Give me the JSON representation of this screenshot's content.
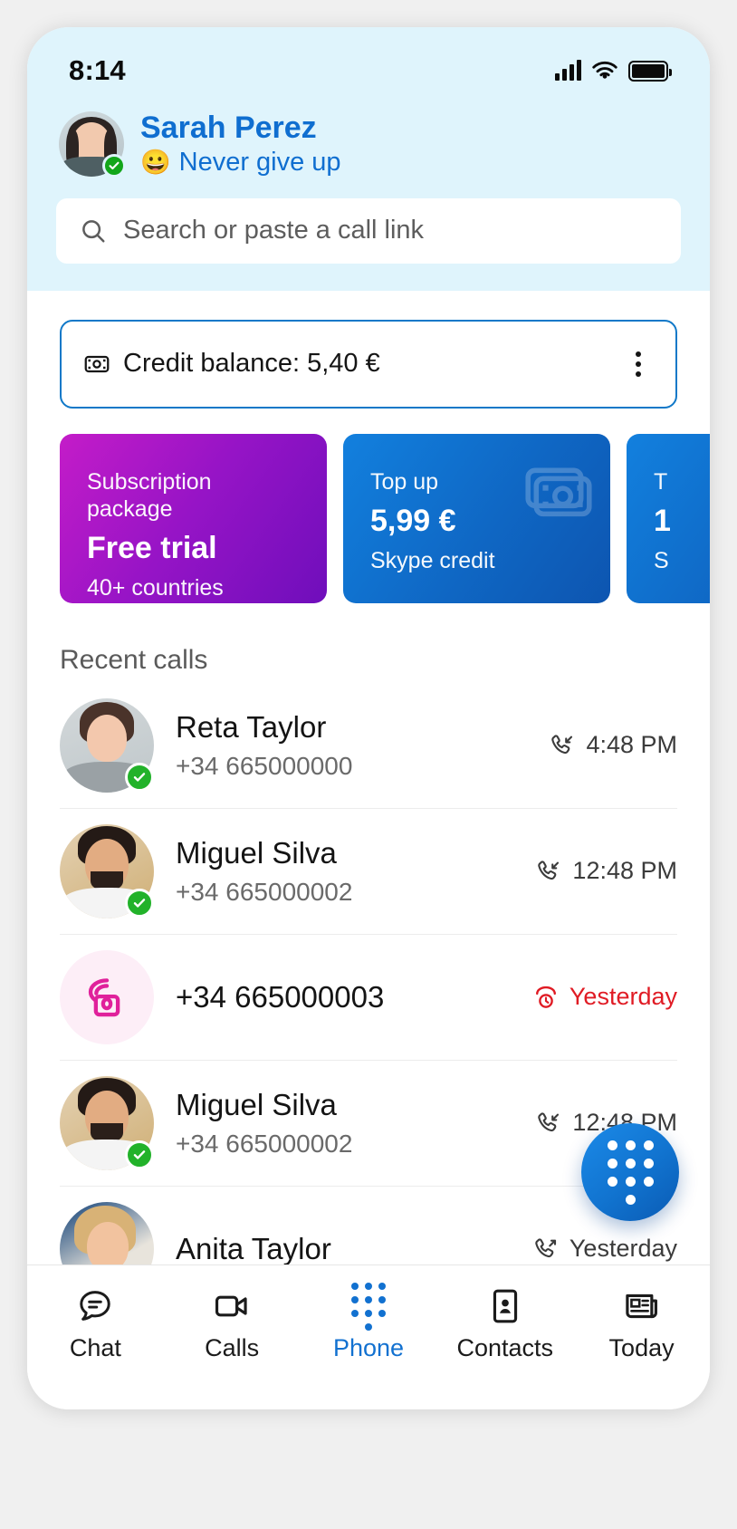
{
  "status_bar": {
    "time": "8:14",
    "signal_icon": "cellular-signal-icon",
    "wifi_icon": "wifi-icon",
    "battery_icon": "battery-full-icon"
  },
  "profile": {
    "name": "Sarah Perez",
    "mood_emoji": "😀",
    "mood_text": "Never give up",
    "presence": "available",
    "avatar_icon": "user-avatar"
  },
  "search": {
    "placeholder": "Search or paste a call link",
    "value": "",
    "icon": "search-icon"
  },
  "credit": {
    "label": "Credit balance: 5,40 €",
    "icon": "banknote-icon",
    "menu_icon": "more-vertical-icon",
    "border_color": "#1078c8"
  },
  "promos": [
    {
      "kicker": "Subscription package",
      "title": "Free trial",
      "sub": "40+ countries",
      "color": "#9614c6",
      "icon": ""
    },
    {
      "kicker": "Top up",
      "title": "5,99 €",
      "sub": "Skype credit",
      "color": "#0f67c4",
      "icon": "banknote-icon"
    },
    {
      "kicker": "T",
      "title": "1",
      "sub": "S",
      "color": "#0f67c4",
      "icon": ""
    }
  ],
  "recent_calls": {
    "title": "Recent calls",
    "rows": [
      {
        "name": "Reta Taylor",
        "number": "+34 665000000",
        "time": "4:48 PM",
        "direction": "incoming",
        "direction_icon": "call-incoming-icon",
        "missed": false,
        "presence": "available",
        "avatar_icon": "contact-photo"
      },
      {
        "name": "Miguel Silva",
        "number": "+34 665000002",
        "time": "12:48 PM",
        "direction": "incoming",
        "direction_icon": "call-incoming-icon",
        "missed": false,
        "presence": "available",
        "avatar_icon": "contact-photo"
      },
      {
        "name": "+34 665000003",
        "number": "",
        "time": "Yesterday",
        "direction": "missed",
        "direction_icon": "call-missed-icon",
        "missed": true,
        "presence": "none",
        "avatar_icon": "dial-phone-icon"
      },
      {
        "name": "Miguel Silva",
        "number": "+34 665000002",
        "time": "12:48 PM",
        "direction": "incoming",
        "direction_icon": "call-incoming-icon",
        "missed": false,
        "presence": "available",
        "avatar_icon": "contact-photo"
      },
      {
        "name": "Anita Taylor",
        "number": "",
        "time": "Yesterday",
        "direction": "outgoing",
        "direction_icon": "call-outgoing-icon",
        "missed": false,
        "presence": "none",
        "avatar_icon": "contact-photo"
      }
    ]
  },
  "fab": {
    "name": "dialpad-fab",
    "icon": "keypad-icon",
    "color": "#1173cf"
  },
  "bottom_nav": {
    "active": "Phone",
    "accent_color": "#1271d0",
    "items": [
      {
        "label": "Chat",
        "icon": "chat-bubble-icon"
      },
      {
        "label": "Calls",
        "icon": "video-camera-icon"
      },
      {
        "label": "Phone",
        "icon": "keypad-icon"
      },
      {
        "label": "Contacts",
        "icon": "contact-card-icon"
      },
      {
        "label": "Today",
        "icon": "news-icon"
      }
    ]
  }
}
